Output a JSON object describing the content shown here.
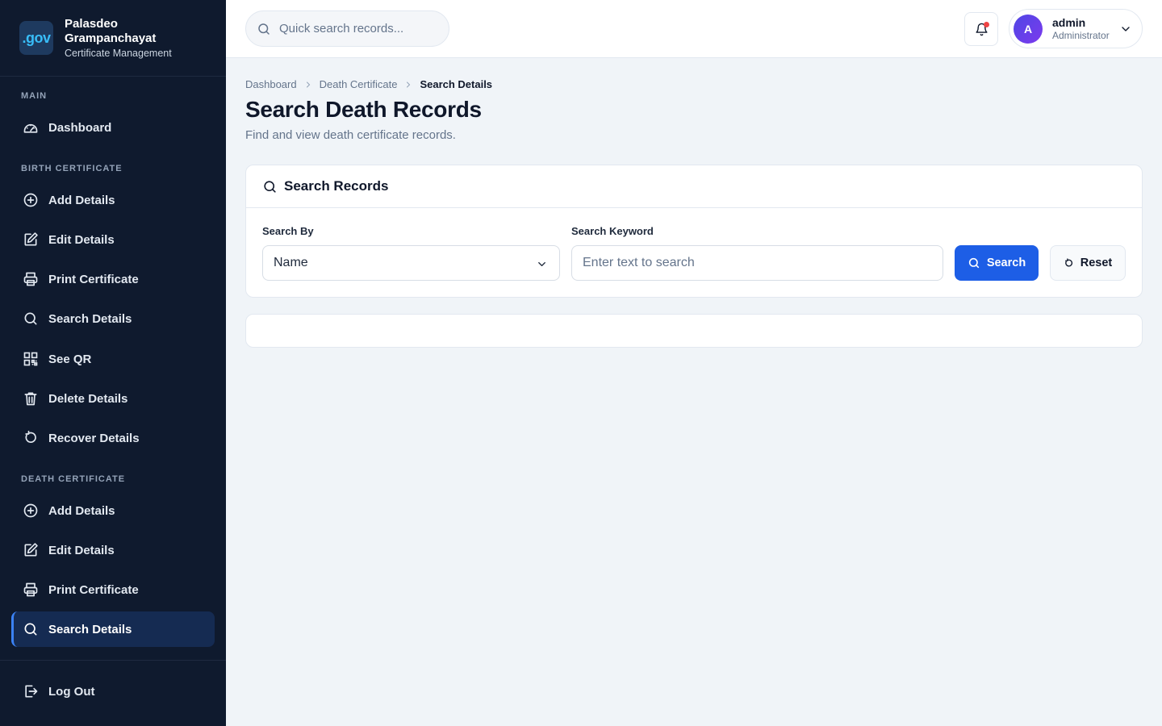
{
  "brand": {
    "logo_text": ".gov",
    "name_line1": "Palasdeo",
    "name_line2": "Grampanchayat",
    "subtitle": "Certificate Management"
  },
  "sidebar": {
    "sections": {
      "main": "MAIN",
      "birth": "BIRTH CERTIFICATE",
      "death": "DEATH CERTIFICATE"
    },
    "main_items": [
      {
        "label": "Dashboard",
        "icon": "dashboard-gauge-icon"
      }
    ],
    "birth_items": [
      {
        "label": "Add Details",
        "icon": "plus-circle-icon"
      },
      {
        "label": "Edit Details",
        "icon": "edit-icon"
      },
      {
        "label": "Print Certificate",
        "icon": "printer-icon"
      },
      {
        "label": "Search Details",
        "icon": "search-icon"
      },
      {
        "label": "See QR",
        "icon": "qr-code-icon"
      },
      {
        "label": "Delete Details",
        "icon": "trash-icon"
      },
      {
        "label": "Recover Details",
        "icon": "refresh-icon"
      }
    ],
    "death_items": [
      {
        "label": "Add Details",
        "icon": "plus-circle-icon"
      },
      {
        "label": "Edit Details",
        "icon": "edit-icon"
      },
      {
        "label": "Print Certificate",
        "icon": "printer-icon"
      },
      {
        "label": "Search Details",
        "icon": "search-icon",
        "active": true
      }
    ],
    "logout": {
      "label": "Log Out",
      "icon": "logout-icon"
    }
  },
  "topbar": {
    "search_placeholder": "Quick search records...",
    "user": {
      "initial": "A",
      "name": "admin",
      "role": "Administrator"
    }
  },
  "breadcrumb": [
    "Dashboard",
    "Death Certificate",
    "Search Details"
  ],
  "page": {
    "title": "Search Death Records",
    "subtitle": "Find and view death certificate records."
  },
  "search_card": {
    "title": "Search Records",
    "search_by_label": "Search By",
    "search_by_value": "Name",
    "keyword_label": "Search Keyword",
    "keyword_placeholder": "Enter text to search",
    "search_button": "Search",
    "reset_button": "Reset"
  },
  "colors": {
    "sidebar_bg": "#0f1a2e",
    "accent": "#1d5ee6",
    "active_item_bg": "#152b52",
    "notification_dot": "#ef4444"
  }
}
